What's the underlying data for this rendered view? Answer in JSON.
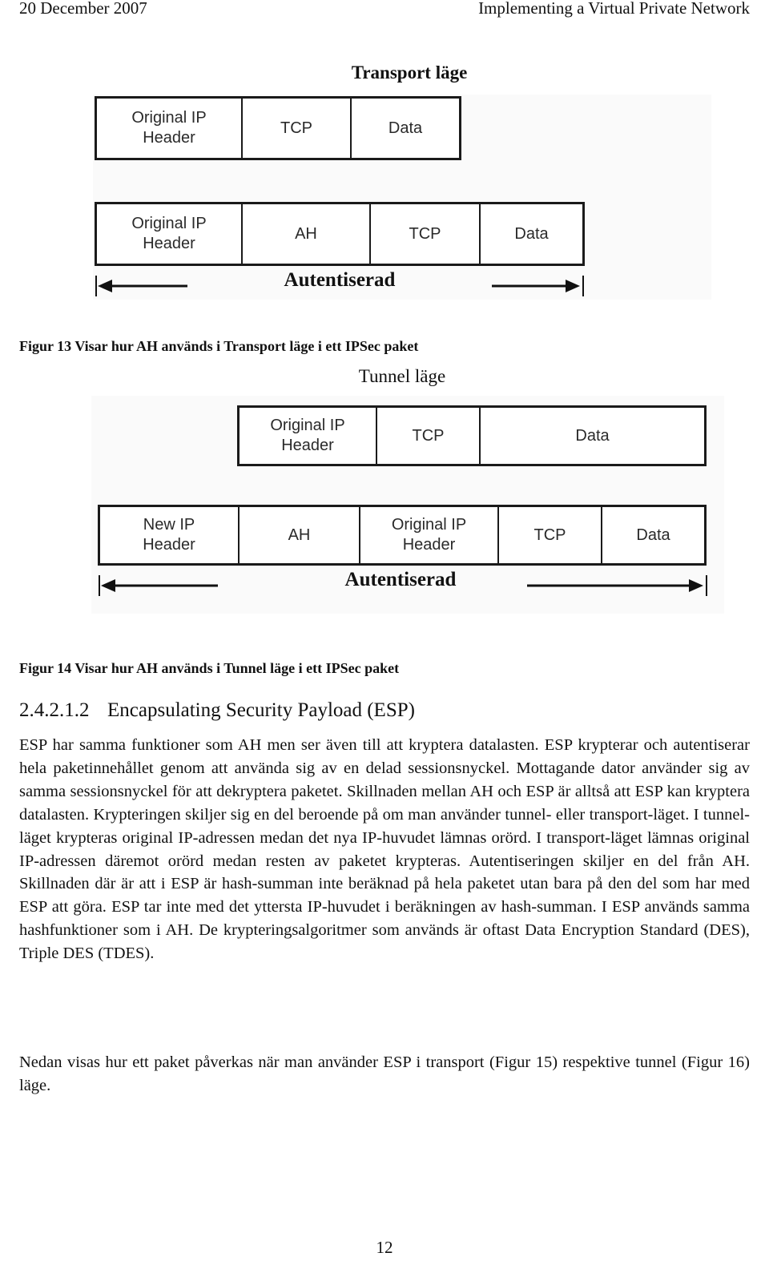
{
  "header": {
    "date": "20 December 2007",
    "title": "Implementing a Virtual Private Network"
  },
  "figure13": {
    "title": "Transport läge",
    "original_packet": [
      "Original IP\nHeader",
      "TCP",
      "Data"
    ],
    "ah_packet": [
      "Original IP\nHeader",
      "AH",
      "TCP",
      "Data"
    ],
    "auth_label": "Autentiserad",
    "caption": "Figur 13 Visar hur AH används i Transport läge i ett IPSec paket"
  },
  "figure14": {
    "title": "Tunnel läge",
    "original_packet": [
      "Original IP\nHeader",
      "TCP",
      "Data"
    ],
    "ah_packet": [
      "New IP\nHeader",
      "AH",
      "Original IP\nHeader",
      "TCP",
      "Data"
    ],
    "auth_label": "Autentiserad",
    "caption": "Figur 14 Visar hur AH används i Tunnel läge i ett IPSec paket"
  },
  "section": {
    "number": "2.4.2.1.2",
    "title": "Encapsulating Security Payload (ESP)"
  },
  "paragraphs": [
    "ESP har samma funktioner som AH men ser även till att kryptera datalasten. ESP krypterar och autentiserar hela paketinnehållet genom att använda sig av en delad sessionsnyckel. Mottagande dator använder sig av samma sessionsnyckel för att dekryptera paketet. Skillnaden mellan AH och ESP är alltså att ESP kan kryptera datalasten. Krypteringen skiljer sig en del beroende på om man använder tunnel- eller transport-läget. I tunnel-läget krypteras original IP-adressen medan det nya IP-huvudet lämnas orörd. I transport-läget lämnas original IP-adressen däremot orörd medan resten av paketet krypteras. Autentiseringen skiljer en del från AH. Skillnaden där är att i ESP är hash-summan inte beräknad på hela paketet utan bara på den del som har med ESP att göra. ESP tar inte med det yttersta IP-huvudet i beräkningen av hash-summan. I ESP används samma hashfunktioner som i AH. De krypteringsalgoritmer som används är oftast Data Encryption Standard (DES), Triple DES (TDES).",
    "Nedan visas hur ett paket påverkas när man använder ESP i transport (Figur 15) respektive tunnel (Figur 16) läge."
  ],
  "page_number": "12"
}
